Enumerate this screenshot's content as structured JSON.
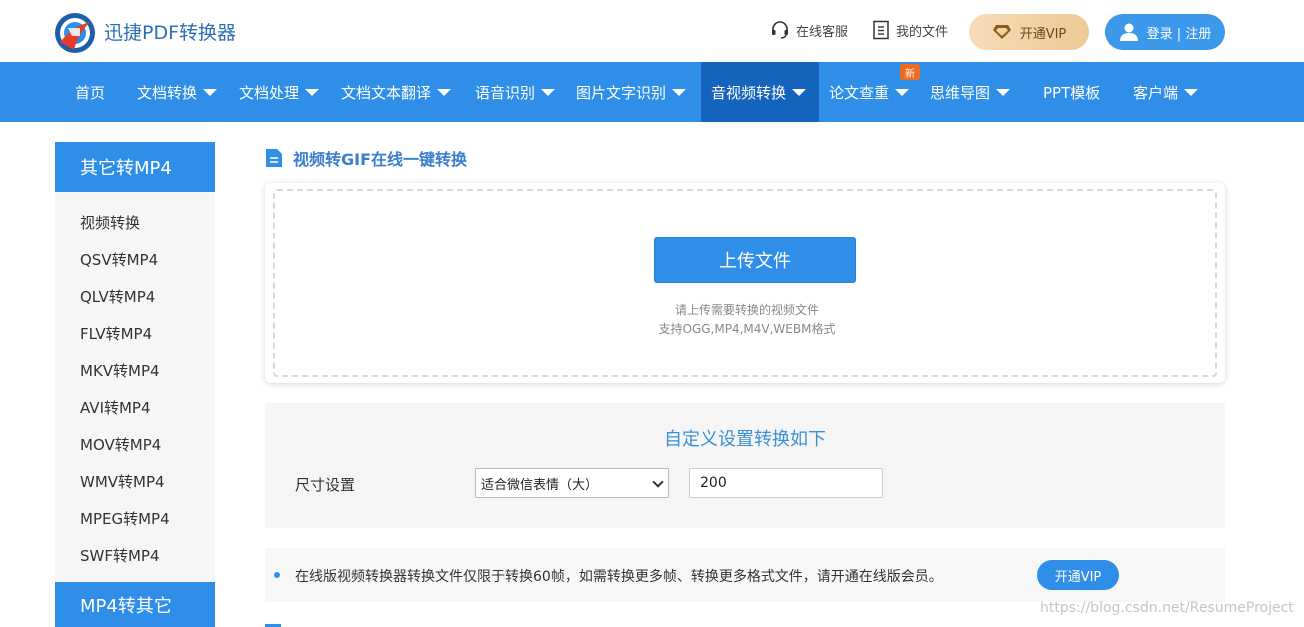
{
  "header": {
    "brand": "迅捷PDF转换器",
    "links": [
      {
        "label": "在线客服",
        "icon": "headset-icon"
      },
      {
        "label": "我的文件",
        "icon": "file-icon"
      }
    ],
    "vip_label": "开通VIP",
    "login_label": "登录 | 注册"
  },
  "nav": {
    "items": [
      {
        "label": "首页",
        "dropdown": false
      },
      {
        "label": "文档转换",
        "dropdown": true
      },
      {
        "label": "文档处理",
        "dropdown": true
      },
      {
        "label": "文档文本翻译",
        "dropdown": true
      },
      {
        "label": "语音识别",
        "dropdown": true
      },
      {
        "label": "图片文字识别",
        "dropdown": true
      },
      {
        "label": "音视频转换",
        "dropdown": true,
        "active": true
      },
      {
        "label": "论文查重",
        "dropdown": true
      },
      {
        "label": "思维导图",
        "dropdown": true
      },
      {
        "label": "PPT模板",
        "dropdown": false
      },
      {
        "label": "客户端",
        "dropdown": true
      }
    ],
    "new_badge": "新"
  },
  "sidebar": {
    "group1_title": "其它转MP4",
    "items": [
      "视频转换",
      "QSV转MP4",
      "QLV转MP4",
      "FLV转MP4",
      "MKV转MP4",
      "AVI转MP4",
      "MOV转MP4",
      "WMV转MP4",
      "MPEG转MP4",
      "SWF转MP4"
    ],
    "group2_title": "MP4转其它"
  },
  "main": {
    "section_title": "视频转GIF在线一键转换",
    "upload_label": "上传文件",
    "hint_line1": "请上传需要转换的视频文件",
    "hint_line2": "支持OGG,MP4,M4V,WEBM格式",
    "settings_title": "自定义设置转换如下",
    "size_label": "尺寸设置",
    "size_select_value": "适合微信表情（大）",
    "size_input_value": "200",
    "notice_text": "在线版视频转换器转换文件仅限于转换60帧，如需转换更多帧、转换更多格式文件，请开通在线版会员。",
    "notice_vip_label": "开通VIP"
  },
  "watermark": "https://blog.csdn.net/ResumeProject",
  "colors": {
    "primary": "#2f8fe8",
    "nav_active": "#1463bd",
    "badge": "#f26b1d",
    "vip_gold": "#efc896"
  }
}
